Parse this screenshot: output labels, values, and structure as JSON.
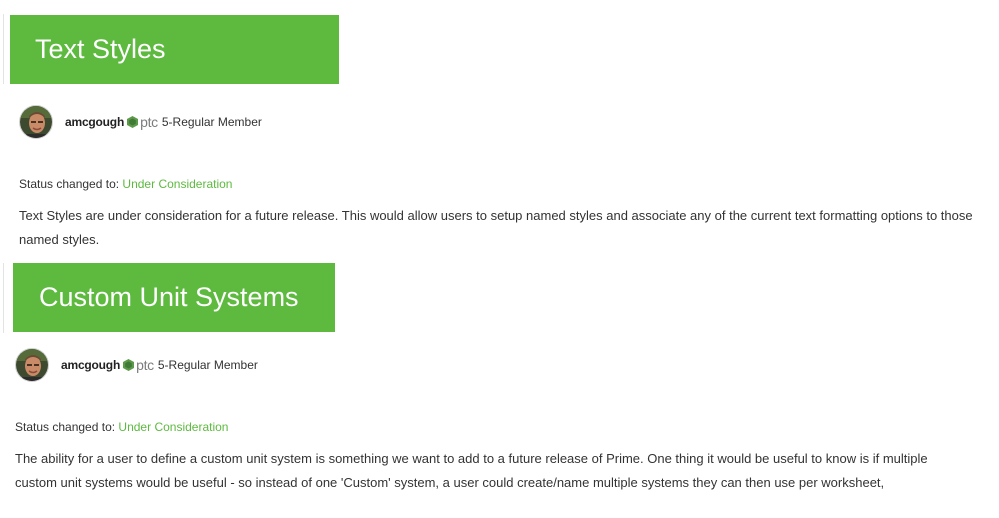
{
  "posts": [
    {
      "title": "Text Styles",
      "author": {
        "username": "amcgough",
        "badge_icon": "ptc-hexagon-icon",
        "badge_text": "ptc",
        "rank": "5-Regular Member"
      },
      "status_label": "Status changed to:",
      "status_value": "Under Consideration",
      "body": "Text Styles are under consideration for a future release. This would allow users to setup named styles and associate any of the current text formatting options to those named styles."
    },
    {
      "title": "Custom Unit Systems",
      "author": {
        "username": "amcgough",
        "badge_icon": "ptc-hexagon-icon",
        "badge_text": "ptc",
        "rank": "5-Regular Member"
      },
      "status_label": "Status changed to:",
      "status_value": "Under Consideration",
      "body": "The ability for a user to define a custom unit system is something we want to add to a future release of Prime. One thing it would be useful to know is if multiple custom unit systems would be useful - so instead of one 'Custom' system, a user could create/name multiple systems they can then use per worksheet,"
    }
  ],
  "colors": {
    "banner_green": "#5dba3f",
    "link_green": "#5dba3f",
    "text": "#333333"
  }
}
